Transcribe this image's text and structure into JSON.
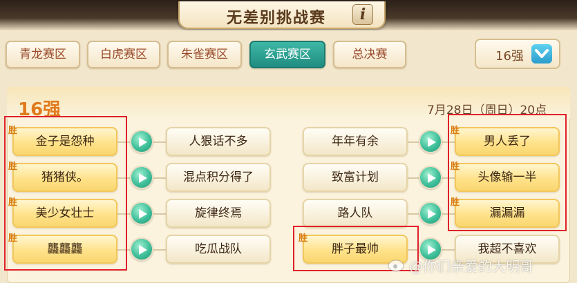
{
  "header": {
    "title": "无差别挑战赛",
    "info_label": "i"
  },
  "tabs": [
    {
      "label": "青龙赛区",
      "active": false
    },
    {
      "label": "白虎赛区",
      "active": false
    },
    {
      "label": "朱雀赛区",
      "active": false
    },
    {
      "label": "玄武赛区",
      "active": true
    },
    {
      "label": "总决赛",
      "active": false
    }
  ],
  "round_select": {
    "value": "16强",
    "icon": "chevron-down-icon"
  },
  "bracket": {
    "round_title": "16强",
    "date": "7月28日（周日）20点",
    "win_label": "胜",
    "matches": [
      {
        "left": "金子是怨种",
        "right": "人狠话不多",
        "winner": "left"
      },
      {
        "left": "猪猪侠。",
        "right": "混点积分得了",
        "winner": "left"
      },
      {
        "left": "美少女壮士",
        "right": "旋律终焉",
        "winner": "left"
      },
      {
        "left": "龘龘龘",
        "right": "吃瓜战队",
        "winner": "left"
      },
      {
        "left": "年年有余",
        "right": "男人丢了",
        "winner": "right"
      },
      {
        "left": "致富计划",
        "right": "头像输一半",
        "winner": "right"
      },
      {
        "left": "路人队",
        "right": "漏漏漏",
        "winner": "right"
      },
      {
        "left": "胖子最帅",
        "right": "我超不喜欢",
        "winner": "left"
      }
    ]
  },
  "watermark": "@你们亲爱的大明哥",
  "colors": {
    "accent_teal": "#1f8c80",
    "winner_gold": "#ffe28a",
    "highlight_red": "#e0202a",
    "round_orange": "#e07a1e"
  }
}
